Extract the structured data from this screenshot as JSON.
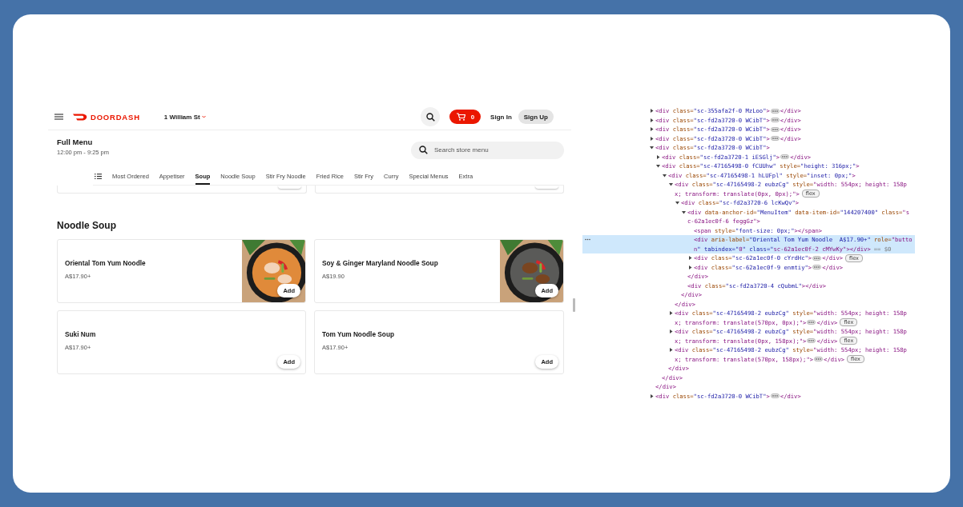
{
  "header": {
    "logo_text": "DOORDASH",
    "address": "1 William St",
    "cart_count": "0",
    "sign_in": "Sign In",
    "sign_up": "Sign Up"
  },
  "menu": {
    "title": "Full Menu",
    "hours": "12:00 pm - 9:25 pm",
    "search": {
      "placeholder": "Search store menu"
    }
  },
  "tabs": [
    {
      "label": "Most Ordered",
      "selected": false
    },
    {
      "label": "Appetiser",
      "selected": false
    },
    {
      "label": "Soup",
      "selected": true
    },
    {
      "label": "Noodle Soup",
      "selected": false
    },
    {
      "label": "Stir Fry Noodle",
      "selected": false
    },
    {
      "label": "Fried Rice",
      "selected": false
    },
    {
      "label": "Stir Fry",
      "selected": false
    },
    {
      "label": "Curry",
      "selected": false
    },
    {
      "label": "Special Menus",
      "selected": false
    },
    {
      "label": "Extra",
      "selected": false
    }
  ],
  "section": {
    "title": "Noodle Soup",
    "items": [
      {
        "name": "Oriental Tom Yum Noodle",
        "price": "A$17.90+",
        "button": "Add"
      },
      {
        "name": "Soy & Ginger Maryland Noodle Soup",
        "price": "A$19.90",
        "button": "Add"
      },
      {
        "name": "Suki Num",
        "price": "A$17.90+",
        "button": "Add"
      },
      {
        "name": "Tom Yum Noodle Soup",
        "price": "A$17.90+",
        "button": "Add"
      }
    ]
  },
  "devtools": {
    "tree": [
      {
        "kind": "node",
        "expanded": false,
        "selected": false,
        "lines": [
          "<div class=\"sc-355afa2f-0 MzLoo\">"
        ],
        "close": "</div>"
      },
      {
        "kind": "node",
        "expanded": false,
        "selected": false,
        "lines": [
          "<div class=\"sc-fd2a3720-0 WCibT\">"
        ],
        "close": "</div>"
      },
      {
        "kind": "node",
        "expanded": false,
        "selected": false,
        "lines": [
          "<div class=\"sc-fd2a3720-0 WCibT\">"
        ],
        "close": "</div>"
      },
      {
        "kind": "node",
        "expanded": false,
        "selected": false,
        "lines": [
          "<div class=\"sc-fd2a3720-0 WCibT\">"
        ],
        "close": "</div>"
      },
      {
        "kind": "node",
        "expanded": true,
        "selected": false,
        "lines": [
          "<div class=\"sc-fd2a3720-0 WCibT\">"
        ],
        "close": "</div>",
        "children": [
          {
            "kind": "node",
            "expanded": false,
            "selected": false,
            "lines": [
              "<div class=\"sc-fd2a3720-1 iESGlj\">"
            ],
            "close": "</div>"
          },
          {
            "kind": "node",
            "expanded": true,
            "selected": false,
            "lines": [
              "<div class=\"sc-47165498-0 fCUUhw\" style=\"height: 316px;\">"
            ],
            "close": "</div>",
            "children": [
              {
                "kind": "node",
                "expanded": true,
                "selected": false,
                "lines": [
                  "<div class=\"sc-47165498-1 hLUFpl\" style=\"inset: 0px;\">"
                ],
                "close": "</div>",
                "children": [
                  {
                    "kind": "node",
                    "expanded": true,
                    "selected": false,
                    "lines": [
                      "<div class=\"sc-47165498-2 eubzCg\" style=\"width: 554px; height: 158p",
                      "x; transform: translate(0px, 0px);\">"
                    ],
                    "badge": "flex",
                    "close": "</div>",
                    "children": [
                      {
                        "kind": "node",
                        "expanded": true,
                        "selected": false,
                        "lines": [
                          "<div class=\"sc-fd2a3720-6 lcKwQv\">"
                        ],
                        "close": "</div>",
                        "children": [
                          {
                            "kind": "node",
                            "expanded": true,
                            "selected": false,
                            "lines": [
                              "<div data-anchor-id=\"MenuItem\" data-item-id=\"144207400\" class=\"s",
                              "c-62a1ec0f-6 feggGz\">"
                            ],
                            "close": "</div>",
                            "children": [
                              {
                                "kind": "leaf",
                                "selected": false,
                                "lines": [
                                  "<span style=\"font-size: 0px;\"></span>"
                                ]
                              },
                              {
                                "kind": "leaf",
                                "selected": true,
                                "lines": [
                                  "<div aria-label=\"Oriental Tom Yum Noodle  A$17.90+\" role=\"butto",
                                  "n\" tabindex=\"0\" class=\"sc-62a1ec0f-2 cMYwKy\"></div>"
                                ],
                                "console_ref": "== $0"
                              },
                              {
                                "kind": "node",
                                "expanded": false,
                                "selected": false,
                                "lines": [
                                  "<div class=\"sc-62a1ec0f-0 cYrdHc\">"
                                ],
                                "close": "</div>",
                                "badge": "flex"
                              },
                              {
                                "kind": "node",
                                "expanded": false,
                                "selected": false,
                                "lines": [
                                  "<div class=\"sc-62a1ec0f-9 enmtiy\">"
                                ],
                                "close": "</div>"
                              }
                            ]
                          },
                          {
                            "kind": "leaf",
                            "selected": false,
                            "lines": [
                              "<div class=\"sc-fd2a3720-4 cQubmL\"></div>"
                            ]
                          }
                        ]
                      }
                    ]
                  },
                  {
                    "kind": "node",
                    "expanded": false,
                    "selected": false,
                    "lines": [
                      "<div class=\"sc-47165498-2 eubzCg\" style=\"width: 554px; height: 158p",
                      "x; transform: translate(570px, 0px);\">"
                    ],
                    "close": "</div>",
                    "badge": "flex"
                  },
                  {
                    "kind": "node",
                    "expanded": false,
                    "selected": false,
                    "lines": [
                      "<div class=\"sc-47165498-2 eubzCg\" style=\"width: 554px; height: 158p",
                      "x; transform: translate(0px, 158px);\">"
                    ],
                    "close": "</div>",
                    "badge": "flex"
                  },
                  {
                    "kind": "node",
                    "expanded": false,
                    "selected": false,
                    "lines": [
                      "<div class=\"sc-47165498-2 eubzCg\" style=\"width: 554px; height: 158p",
                      "x; transform: translate(570px, 158px);\">"
                    ],
                    "close": "</div>",
                    "badge": "flex"
                  }
                ]
              }
            ]
          }
        ]
      },
      {
        "kind": "node",
        "expanded": false,
        "selected": false,
        "lines": [
          "<div class=\"sc-fd2a3720-0 WCibT\">"
        ],
        "close": "</div>"
      }
    ]
  }
}
